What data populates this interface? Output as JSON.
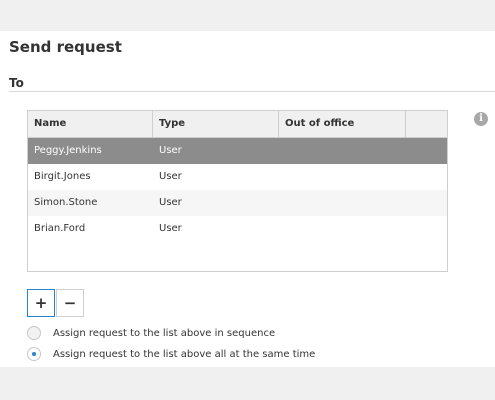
{
  "header": {
    "title": "Send request"
  },
  "section": {
    "label": "To"
  },
  "table": {
    "columns": [
      "Name",
      "Type",
      "Out of office"
    ],
    "rows": [
      {
        "name": "Peggy.Jenkins",
        "type": "User",
        "out_of_office": "",
        "selected": true
      },
      {
        "name": "Birgit.Jones",
        "type": "User",
        "out_of_office": ""
      },
      {
        "name": "Simon.Stone",
        "type": "User",
        "out_of_office": ""
      },
      {
        "name": "Brian.Ford",
        "type": "User",
        "out_of_office": ""
      }
    ]
  },
  "buttons": {
    "add": "+",
    "remove": "−"
  },
  "options": {
    "sequence": "Assign request to the list above in sequence",
    "same_time": "Assign request to the list above all at the same time",
    "selected": "same_time"
  },
  "icons": {
    "info": "info-icon",
    "info_glyph": "i"
  },
  "colors": {
    "accent": "#2a84c9",
    "selected_row": "#8c8c8c"
  }
}
